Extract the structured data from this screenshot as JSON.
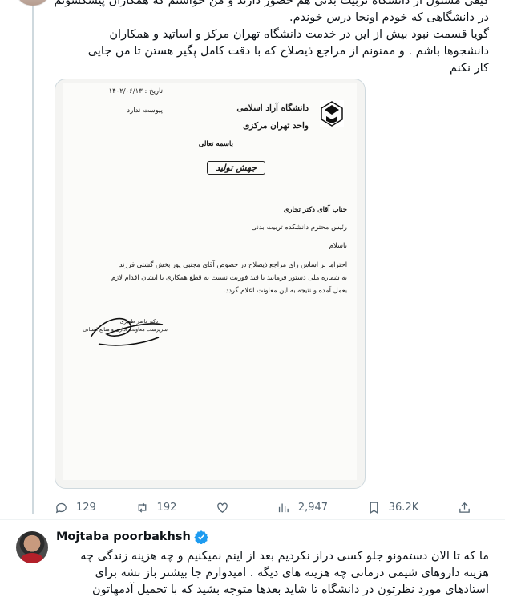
{
  "tweet": {
    "text_lines": [
      "کیفی مسئول از دانشگاه تربیت بدنی هم حضور دارند و من خواستم که همکاران پیشکسوتم",
      "در دانشگاهی که خودم  اونجا درس خوندم.",
      "گویا قسمت نبود بیش از این در خدمت دانشگاه تهران مرکز و اساتید و همکاران",
      "دانشجوها باشم . و ممنونم از مراجع ذیصلاح که با دقت  کامل پگیر هستن تا من جایی",
      "کار نکنم"
    ],
    "stats": {
      "replies": "129",
      "retweets": "192",
      "likes": "",
      "views": "2,947",
      "bookmarks": "36.2K"
    }
  },
  "document": {
    "date_label": "تاریخ : ۱۴۰۲/۰۶/۱۳",
    "attachment_label": "پیوست ندارد",
    "university": "دانشگاه آزاد اسلامی",
    "branch": "واحد تهران مرکزی",
    "basmala": "باسمه تعالی",
    "slogan": "جهش تولید",
    "recipient": "جناب آقای دکتر تجاری",
    "recipient_title": "رئیس محترم دانشکده تربیت بدنی",
    "greeting": "باسلام",
    "body_lines": [
      "احتراما بر اساس رای مراجع ذیصلاح در خصوص آقای مجتبی پور بخش گشتی  فرزند",
      "به شماره ملی                 دستور فرمایید با قید فوریت نسبت به قطع همکاری با ایشان اقدام لازم",
      "بعمل آمده و نتیجه به این معاونت اعلام گردد."
    ],
    "signer_name": "دکتر ناصر ظهیری",
    "signer_title": "سرپرست معاونت اداری و منابع انسانی"
  },
  "reply": {
    "name": "Mojtaba poorbakhsh",
    "text_lines": [
      "ما که تا الان دستمونو جلو کسی دراز نکردیم بعد از اینم نمیکنیم و چه هزینه زندگی چه",
      "هزینه داروهای شیمی درمانی چه هزینه های دیگه . امیدوارم جا بیشتر  باز بشه برای",
      "استادهای مورد نظرتون در دانشگاه تا شاید  بعدها  متوجه بشید که  با تحمیل آدمهاتون"
    ]
  },
  "colors": {
    "verified": "#1d9bf0",
    "muted": "#536471"
  }
}
